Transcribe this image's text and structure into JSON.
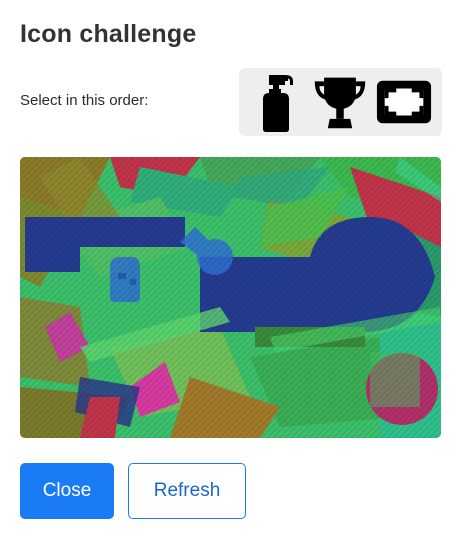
{
  "dialog": {
    "title": "Icon challenge",
    "instruction": "Select in this order:"
  },
  "target_icons": [
    {
      "icon": "spray-bottle-icon"
    },
    {
      "icon": "trophy-icon"
    },
    {
      "icon": "film-frame-icon"
    }
  ],
  "buttons": {
    "close_label": "Close",
    "refresh_label": "Refresh"
  },
  "colors": {
    "primary": "#1a7cf5",
    "icon_strip_bg": "#eeeeee"
  }
}
